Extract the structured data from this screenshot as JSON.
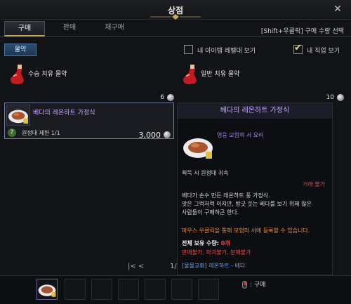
{
  "window": {
    "title": "상점",
    "close_icon": "close-icon"
  },
  "tabs": [
    {
      "label": "구매",
      "active": true
    },
    {
      "label": "판매",
      "active": false
    },
    {
      "label": "재구매",
      "active": false
    }
  ],
  "hint": "[Shift+우클릭] 구매 수량 선택",
  "filter_button": "물약",
  "checkboxes": [
    {
      "label": "내 아이템 레벨대 보기",
      "checked": false
    },
    {
      "label": "내 직업 보기",
      "checked": true
    }
  ],
  "items": [
    {
      "name": "수습 치유 물약",
      "price": "6",
      "icon": "red-potion-icon"
    },
    {
      "name": "일반 치유 물약",
      "price": "10",
      "icon": "red-potion-icon"
    }
  ],
  "selected_item": {
    "name": "베다의 레온하트 가정식",
    "limit": "원정대 제한 1/1",
    "price": "3,000",
    "icon": "dish-icon"
  },
  "tooltip": {
    "title": "베다의 레온하트 가정식",
    "subtitle": "영웅 모험의 서 요리",
    "bind": "획득 시 원정대 귀속",
    "trade": "거래 불가",
    "desc": [
      "베다가 손수 만든 레온하트 풍 가정식.",
      "맛은 그럭저럭 이지만, 방긋 웃는 베다를 보기 위해 많은",
      "사람들이 구매하곤 한다."
    ],
    "usage": "마우스 우클릭을 통해 모험의 서에 등록할 수 있습니다.",
    "owned_label": "전체 보유 수량: ",
    "owned_value": "0개",
    "restrictions": "판매불가, 파괴불가, 분해불가",
    "exchange": "[물물교환] 레온하트 - 베다"
  },
  "pager": {
    "arrows": "|<  <",
    "page": "1/"
  },
  "bottom_hint": ": 구매",
  "colors": {
    "selected_name": "#c8a4ff",
    "warning": "#e04848",
    "usage": "#f28c2e",
    "exchange": "#5fa4ee"
  }
}
